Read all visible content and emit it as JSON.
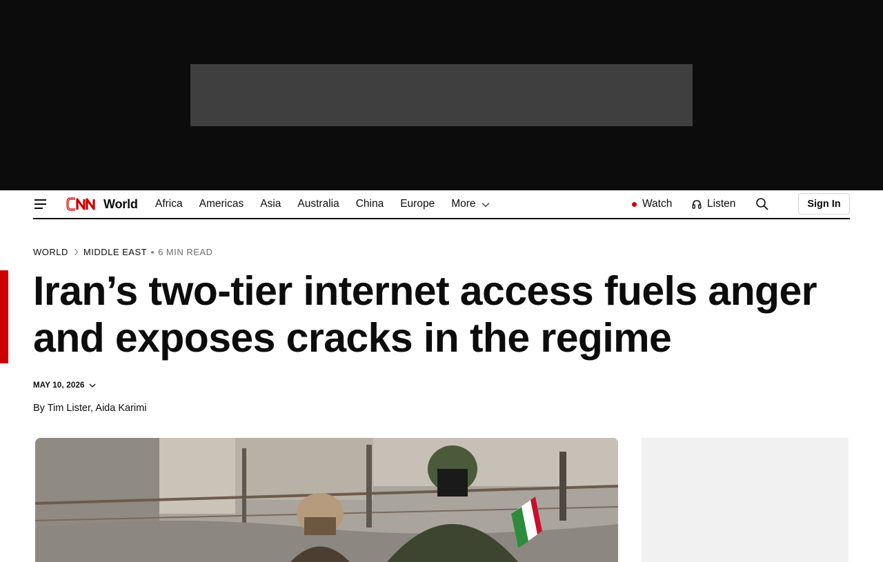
{
  "brand": {
    "logo_text": "CNN",
    "section": "World",
    "accent_color": "#cc0000"
  },
  "nav": {
    "links": [
      "Africa",
      "Americas",
      "Asia",
      "Australia",
      "China",
      "Europe"
    ],
    "more_label": "More",
    "watch_label": "Watch",
    "listen_label": "Listen",
    "signin_label": "Sign In"
  },
  "breadcrumb": {
    "section": "WORLD",
    "subsection": "MIDDLE EAST",
    "read_time": "6 MIN READ"
  },
  "article": {
    "headline": "Iran’s two-tier internet access fuels anger and exposes cracks in the regime",
    "date": "MAY 10, 2026",
    "by_prefix": "By",
    "author_1": "Tim Lister",
    "author_sep": ",",
    "author_2": "Aida Karimi"
  },
  "icons": [
    "menu-icon",
    "chevron-right-icon",
    "chevron-down-icon",
    "headphones-icon",
    "search-icon"
  ]
}
